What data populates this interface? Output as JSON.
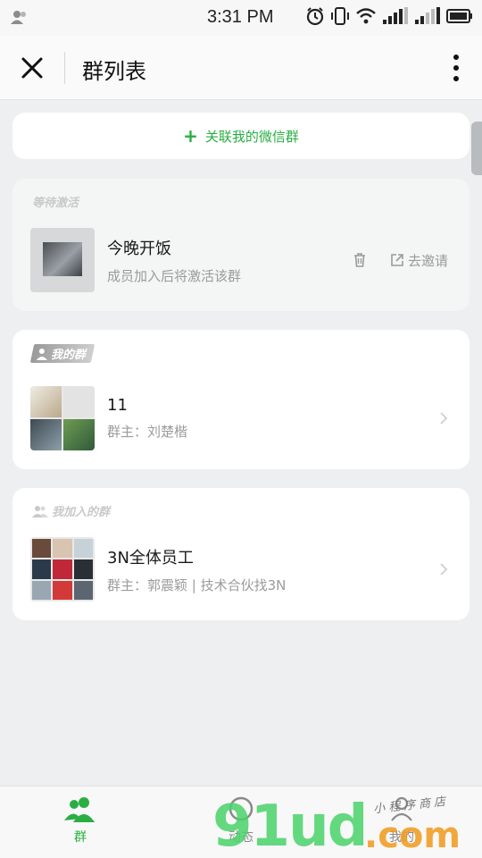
{
  "status_bar": {
    "time": "3:31 PM",
    "icons": [
      "user-icon",
      "alarm-icon",
      "vibrate-icon",
      "wifi-icon",
      "signal-icon",
      "signal-icon",
      "battery-icon"
    ]
  },
  "header": {
    "title": "群列表",
    "close_icon": "close-icon",
    "more_icon": "more-vertical-icon"
  },
  "link_group": {
    "plus": "+",
    "label": "关联我的微信群"
  },
  "pending_section": {
    "label": "等待激活",
    "group": {
      "name": "今晚开饭",
      "subtitle": "成员加入后将激活该群",
      "invite_label": "去邀请"
    }
  },
  "my_groups_section": {
    "label": "我的群",
    "group": {
      "name": "11",
      "subtitle": "群主：刘楚楷"
    }
  },
  "joined_section": {
    "label": "我加入的群",
    "group": {
      "name": "3N全体员工",
      "subtitle": "群主：郭震颖 | 技术合伙找3N"
    }
  },
  "tabbar": {
    "tabs": [
      {
        "label": "群",
        "active": true
      },
      {
        "label": "动态",
        "active": false
      },
      {
        "label": "我的",
        "active": false
      }
    ]
  },
  "watermark": {
    "big": "91ud",
    "com": ".com",
    "small": "小程序商店"
  },
  "colors": {
    "accent": "#2aae43",
    "background": "#edeff0",
    "muted_text": "#9b9b9b"
  }
}
